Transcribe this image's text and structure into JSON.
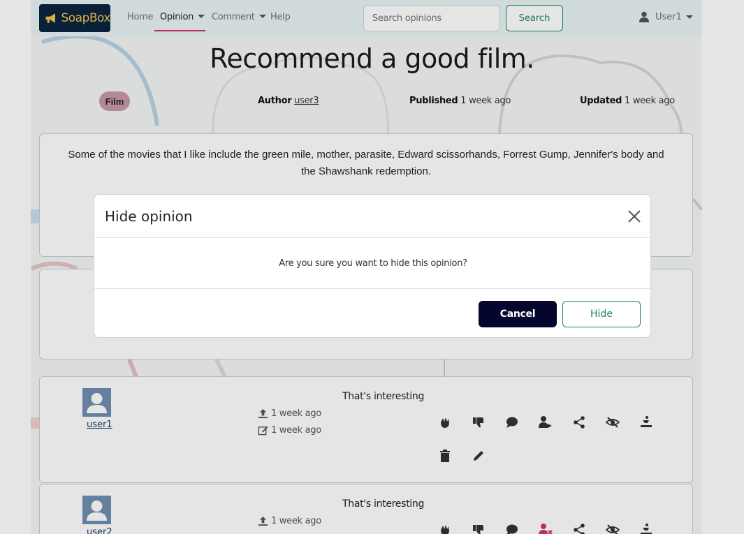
{
  "navbar": {
    "brand": "SoapBox",
    "links": [
      "Home",
      "Opinion",
      "Comment",
      "Help"
    ],
    "search_placeholder": "Search opinions",
    "search_button": "Search",
    "user": "User1"
  },
  "opinion": {
    "title": "Recommend a good film.",
    "category": "Film",
    "author_label": "Author",
    "author": "user3",
    "published_label": "Published",
    "published": "1 week ago",
    "updated_label": "Updated",
    "updated": "1 week ago",
    "body": "Some of the movies that I like include the green mile, mother, parasite, Edward scissorhands, Forrest Gump, Jennifer's body and the Shawshank redemption."
  },
  "comments": [
    {
      "user": "user1",
      "created": "1 week ago",
      "edited": "1 week ago",
      "text": "That's interesting"
    },
    {
      "user": "user2",
      "created": "1 week ago",
      "text": "That's interesting"
    }
  ],
  "modal": {
    "title": "Hide opinion",
    "message": "Are you sure you want to hide this opinion?",
    "cancel": "Cancel",
    "confirm": "Hide"
  },
  "colors": {
    "brand_bg": "#0b2440",
    "brand_text": "#f2c14e",
    "accent_green": "#198754",
    "cancel_bg": "#05062e",
    "active_underline": "#d6336c",
    "badge_bg": "#c79aa7"
  }
}
